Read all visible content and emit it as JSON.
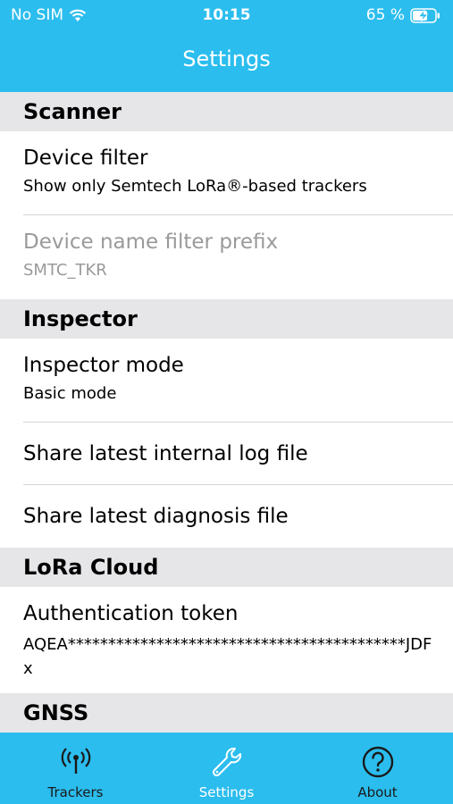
{
  "status_bar": {
    "carrier": "No SIM",
    "time": "10:15",
    "battery": "65 %"
  },
  "nav": {
    "title": "Settings"
  },
  "sections": {
    "scanner": {
      "header": "Scanner",
      "device_filter": {
        "title": "Device filter",
        "value": "Show only Semtech LoRa®-based trackers"
      },
      "name_prefix": {
        "title": "Device name filter prefix",
        "value": "SMTC_TKR"
      }
    },
    "inspector": {
      "header": "Inspector",
      "mode": {
        "title": "Inspector mode",
        "value": "Basic mode"
      },
      "share_log": {
        "title": "Share latest internal log file"
      },
      "share_diagnosis": {
        "title": "Share latest diagnosis file"
      }
    },
    "lora_cloud": {
      "header": "LoRa Cloud",
      "token": {
        "title": "Authentication token",
        "value": "AQEA******************************************JDFx"
      }
    },
    "gnss": {
      "header": "GNSS"
    }
  },
  "tabbar": {
    "items": [
      {
        "label": "Trackers",
        "icon": "antenna-icon",
        "active": false
      },
      {
        "label": "Settings",
        "icon": "wrench-icon",
        "active": true
      },
      {
        "label": "About",
        "icon": "question-circle-icon",
        "active": false
      }
    ]
  },
  "colors": {
    "accent": "#2bbdee",
    "section_bg": "#e6e6e8",
    "disabled_text": "#9a9a9a"
  }
}
